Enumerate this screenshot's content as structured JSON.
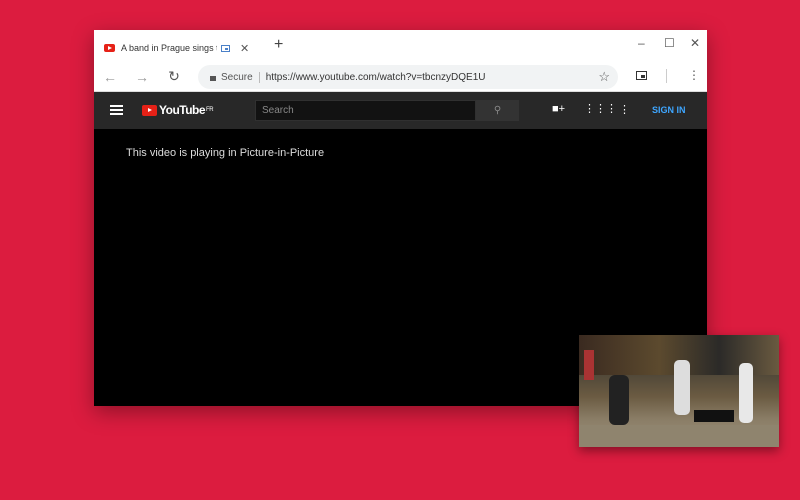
{
  "browser": {
    "tab_title": "A band in Prague sings the",
    "url_secure_label": "Secure",
    "url": "https://www.youtube.com/watch?v=tbcnzyDQE1U"
  },
  "youtube": {
    "logo": "YouTube",
    "region": "FR",
    "search_placeholder": "Search",
    "sign_in": "SIGN IN"
  },
  "player": {
    "message": "This video is playing in Picture-in-Picture"
  },
  "colors": {
    "background": "#dc1c3f",
    "accent": "#3ea6ff",
    "brand": "#e62117"
  }
}
